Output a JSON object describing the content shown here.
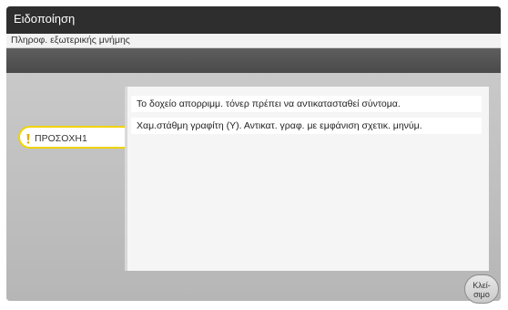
{
  "header": {
    "title": "Ειδοποίηση",
    "subtitle": "Πληροφ. εξωτερικής μνήμης"
  },
  "alert_tab": {
    "icon": "warning-icon",
    "label": "ΠΡΟΣΟΧΗ1"
  },
  "messages": [
    "Το δοχείο απορριμμ. τόνερ πρέπει να αντικατασταθεί σύντομα.",
    "Χαμ.στάθμη γραφίτη (Y). Αντικατ. γραφ. με εμφάνιση σχετικ. μηνύμ."
  ],
  "footer": {
    "close_label": "Κλεί-\nσιμο"
  },
  "colors": {
    "titlebar": "#2e2e2e",
    "accent": "#f0d200"
  }
}
